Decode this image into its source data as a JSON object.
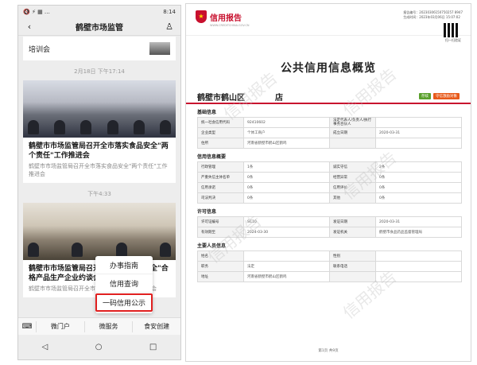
{
  "phone": {
    "status_left": "🔇 ⚡ ▦ …",
    "status_right": "8:14",
    "nav_title": "鹤壁市场监管",
    "back_icon": "‹",
    "user_icon": "♙",
    "top_card_text": "培训会",
    "time1": "2月18日 下午17:14",
    "article1": {
      "title": "鹤壁市市场监管局召开全市落实食品安全\"两个责任\"工作推进会",
      "subtitle": "鹤壁市市场监管局召开全市落实食品安全\"两个责任\"工作推进会"
    },
    "time2": "下午4:33",
    "article2": {
      "title": "鹤壁市市场监管局召开全市落实食品安全\"合格产品生产企业约谈会",
      "subtitle": "鹤壁市市场监管局召开全市落实食品生产企业约谈会"
    },
    "popup_items": [
      "办事指南",
      "信用查询",
      "一码信用公示"
    ],
    "menu": [
      "微门户",
      "微服务",
      "食安创建"
    ],
    "sysnav": [
      "◁",
      "○",
      "□"
    ]
  },
  "report": {
    "logo_text": "信用报告",
    "logo_sub": "WWW.CREDITCHINA.GOV.CN",
    "report_ids": [
      "报告编号：20230306150750257 8947",
      "生成时间：2023年03月06日 15:07:02"
    ],
    "qr_label": "扫一扫验证",
    "title": "公共信用信息概览",
    "entity_name": "鹤壁市鹤山区",
    "entity_suffix": "店",
    "tags": [
      {
        "label": "存续",
        "color": "#5aa02c"
      },
      {
        "label": "守信激励对象",
        "color": "#e85a1a"
      }
    ],
    "sections": [
      {
        "title": "基础信息",
        "rows": [
          [
            "统一社会信用代码",
            "92410602",
            "法定代表人/负责人/执行事务合伙人",
            ""
          ],
          [
            "企业类型",
            "个体工商户",
            "成立日期",
            "2020-03-31"
          ],
          [
            "住所",
            "河南省鹤壁市鹤山区鹤鸣",
            "",
            ""
          ]
        ]
      },
      {
        "title": "信用信息概要",
        "rows": [
          [
            "行政管理",
            "1条",
            "诚实守信",
            "2条"
          ],
          [
            "严重失信主体名单",
            "0条",
            "经营异常",
            "0条"
          ],
          [
            "信用承诺",
            "0条",
            "信用评价",
            "0条"
          ],
          [
            "司法判决",
            "0条",
            "其他",
            "0条"
          ]
        ]
      },
      {
        "title": "许可信息",
        "rows": [
          [
            "许可证编号",
            "SC10",
            "发证日期",
            "2020-03-31"
          ],
          [
            "有效期至",
            "2024-03-30",
            "发证机关",
            "鹤壁市食品药品监督管理局"
          ]
        ]
      },
      {
        "title": "主要人员信息",
        "rows": [
          [
            "姓名",
            "",
            "性别",
            ""
          ],
          [
            "职务",
            "法定",
            "联系电话",
            ""
          ],
          [
            "地址",
            "河南省鹤壁市鹤山区鹤鸣",
            "",
            ""
          ]
        ]
      }
    ],
    "watermark_text": "信用报告",
    "footer": "第1页  共9页"
  }
}
